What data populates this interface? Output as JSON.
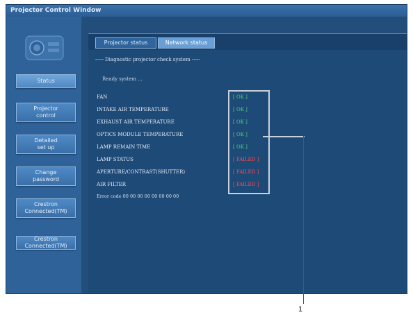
{
  "window": {
    "title": "Projector Control Window"
  },
  "sidebar": {
    "items": [
      {
        "label": "Status",
        "active": true
      },
      {
        "label": "Projector\ncontrol",
        "active": false
      },
      {
        "label": "Detailed\nset up",
        "active": false
      },
      {
        "label": "Change\npassword",
        "active": false
      },
      {
        "label": "Crestron\nConnected(TM)",
        "active": false
      },
      {
        "label": "Crestron\nConnected(TM)",
        "active": false
      }
    ]
  },
  "tabs": [
    {
      "label": "Projector status",
      "active": false
    },
    {
      "label": "Network status",
      "active": true
    }
  ],
  "self_test": {
    "title": "----- Diagnostic projector check system -----",
    "status_label": "Ready system ...",
    "items": [
      {
        "label": "FAN",
        "value": "[ OK ]",
        "state": "ok"
      },
      {
        "label": "INTAKE AIR TEMPERATURE",
        "value": "[ OK ]",
        "state": "ok"
      },
      {
        "label": "EXHAUST AIR TEMPERATURE",
        "value": "[ OK ]",
        "state": "ok"
      },
      {
        "label": "OPTICS MODULE TEMPERATURE",
        "value": "[ OK ]",
        "state": "ok"
      },
      {
        "label": "LAMP REMAIN TIME",
        "value": "[ OK ]",
        "state": "ok"
      },
      {
        "label": "LAMP STATUS",
        "value": "[ FAILED ]",
        "state": "error"
      },
      {
        "label": "APERTURE/CONTRAST(SHUTTER)",
        "value": "[ FAILED ]",
        "state": "error"
      },
      {
        "label": "AIR FILTER",
        "value": "[ FAILED ]",
        "state": "error"
      }
    ],
    "error_log": "Error code 00 00 00 00 00 00 00 00"
  },
  "annotation": {
    "callout_number": "1"
  },
  "colors": {
    "ok": "#4fd07a",
    "error": "#ff4a4a",
    "window": "#2a5b8e",
    "highlight": "#c9d2dc"
  }
}
